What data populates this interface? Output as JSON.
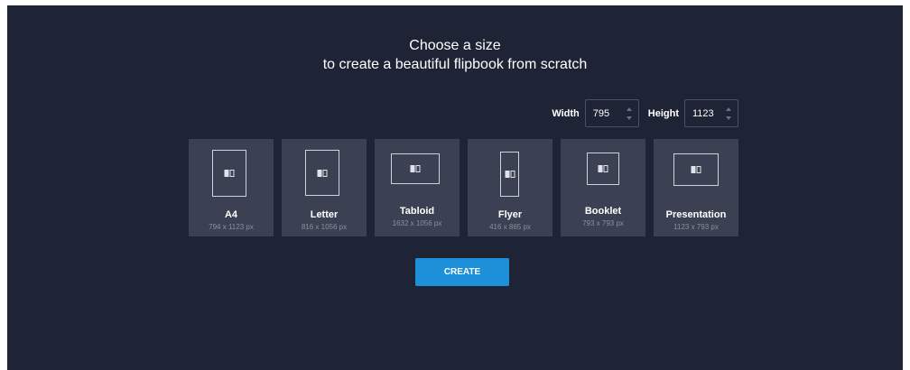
{
  "heading": {
    "line1": "Choose a size",
    "line2": "to create a beautiful flipbook from scratch"
  },
  "dimensions": {
    "width_label": "Width",
    "width_value": "795",
    "height_label": "Height",
    "height_value": "1123"
  },
  "sizes": [
    {
      "name": "A4",
      "size": "794 x 1123 px",
      "icon": "portrait-page-icon"
    },
    {
      "name": "Letter",
      "size": "816 x 1056 px",
      "icon": "portrait-page-icon"
    },
    {
      "name": "Tabloid",
      "size": "1632 x 1056 px",
      "icon": "landscape-page-icon"
    },
    {
      "name": "Flyer",
      "size": "416 x 865 px",
      "icon": "narrow-page-icon"
    },
    {
      "name": "Booklet",
      "size": "793 x 793 px",
      "icon": "square-page-icon"
    },
    {
      "name": "Presentation",
      "size": "1123 x 793 px",
      "icon": "landscape-page-icon"
    }
  ],
  "create_label": "CREATE",
  "colors": {
    "background": "#1e2435",
    "card": "#3b4152",
    "accent": "#1e90d9"
  }
}
